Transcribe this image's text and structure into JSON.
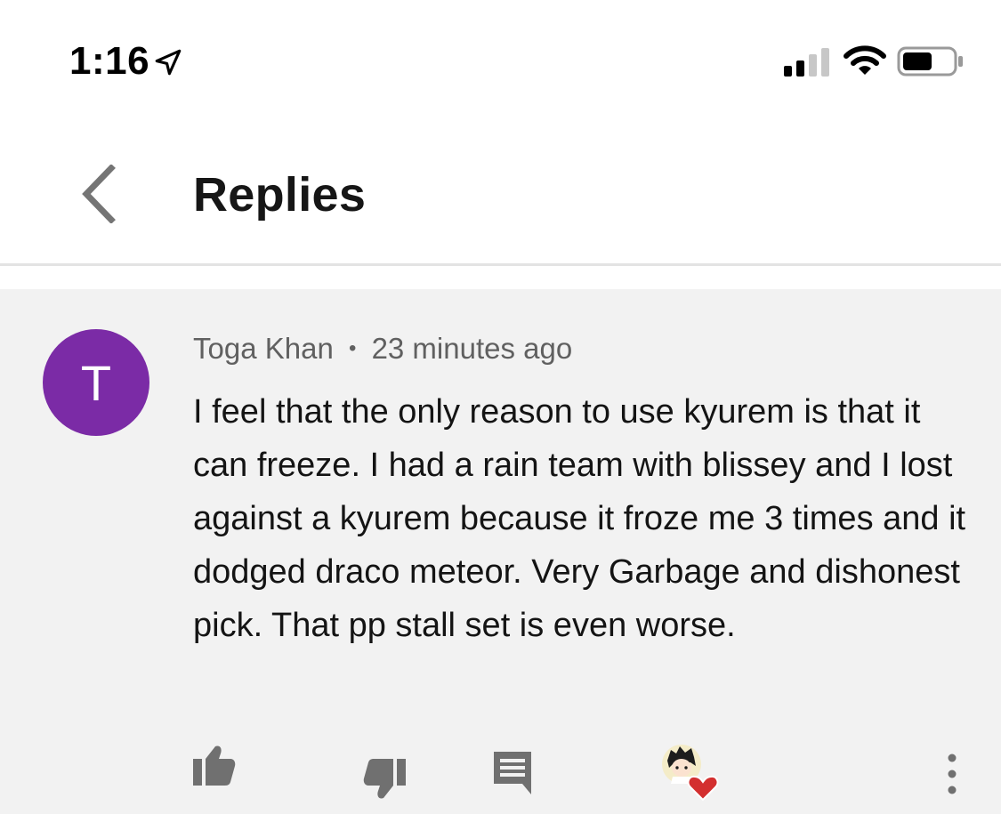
{
  "status_bar": {
    "time": "1:16",
    "icons": [
      "location-arrow-icon",
      "signal-bars-icon",
      "wifi-icon",
      "battery-icon"
    ]
  },
  "header": {
    "title": "Replies",
    "back_icon": "chevron-left-icon"
  },
  "comment": {
    "avatar_letter": "T",
    "avatar_color": "#7b2ba6",
    "author": "Toga Khan",
    "separator": "•",
    "time_ago": "23 minutes ago",
    "text": "I feel that the only reason to use kyurem is that it can freeze. I had a rain team with blissey and I lost against a kyurem because it froze me 3 times and it dodged draco meteor. Very Garbage and dishonest pick. That pp stall set is even worse."
  },
  "actions": {
    "icons": [
      "thumbs-up-icon",
      "thumbs-down-icon",
      "reply-comment-icon",
      "creator-heart-icon",
      "more-vertical-icon"
    ],
    "heart_color": "#d32f2f"
  },
  "colors": {
    "background": "#ffffff",
    "comment_background": "#f2f2f2",
    "divider": "#e3e3e3",
    "meta_text": "#606060",
    "icon_gray": "#707070"
  }
}
